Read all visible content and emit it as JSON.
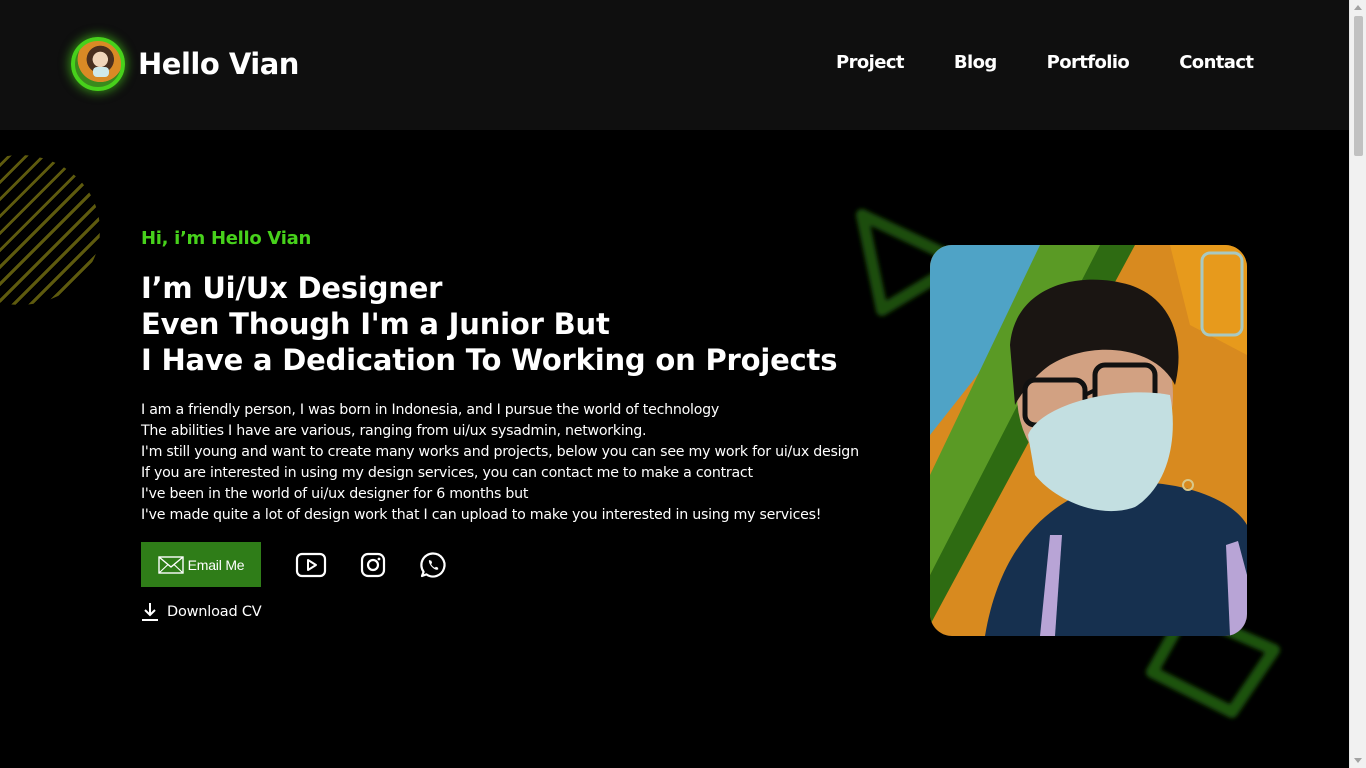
{
  "header": {
    "brand_name": "Hello Vian",
    "nav": [
      "Project",
      "Blog",
      "Portfolio",
      "Contact"
    ]
  },
  "hero": {
    "intro": "Hi, i’m Hello Vian",
    "headline": [
      "I’m Ui/Ux Designer",
      "Even Though I'm a Junior But",
      "I Have a Dedication To Working on Projects"
    ],
    "bio": [
      "I am a friendly person, I was born in Indonesia, and I pursue the world of technology",
      "The abilities I have are various, ranging from ui/ux sysadmin, networking.",
      "I'm still young and want to create many works and projects, below you can see my work for ui/ux design",
      "If you are interested in using my design services, you can contact me to make a contract",
      "I've been in the world of ui/ux designer for 6 months but",
      "I've made quite a lot of design work that I can upload to make you interested in using my services!"
    ],
    "email_button": "Email Me",
    "download_label": "Download CV",
    "social_icons": [
      "youtube-icon",
      "instagram-icon",
      "whatsapp-icon"
    ]
  },
  "colors": {
    "accent": "#47d11b",
    "button": "#2f7d18",
    "header_bg": "#0f0f0f",
    "page_bg": "#000000"
  }
}
